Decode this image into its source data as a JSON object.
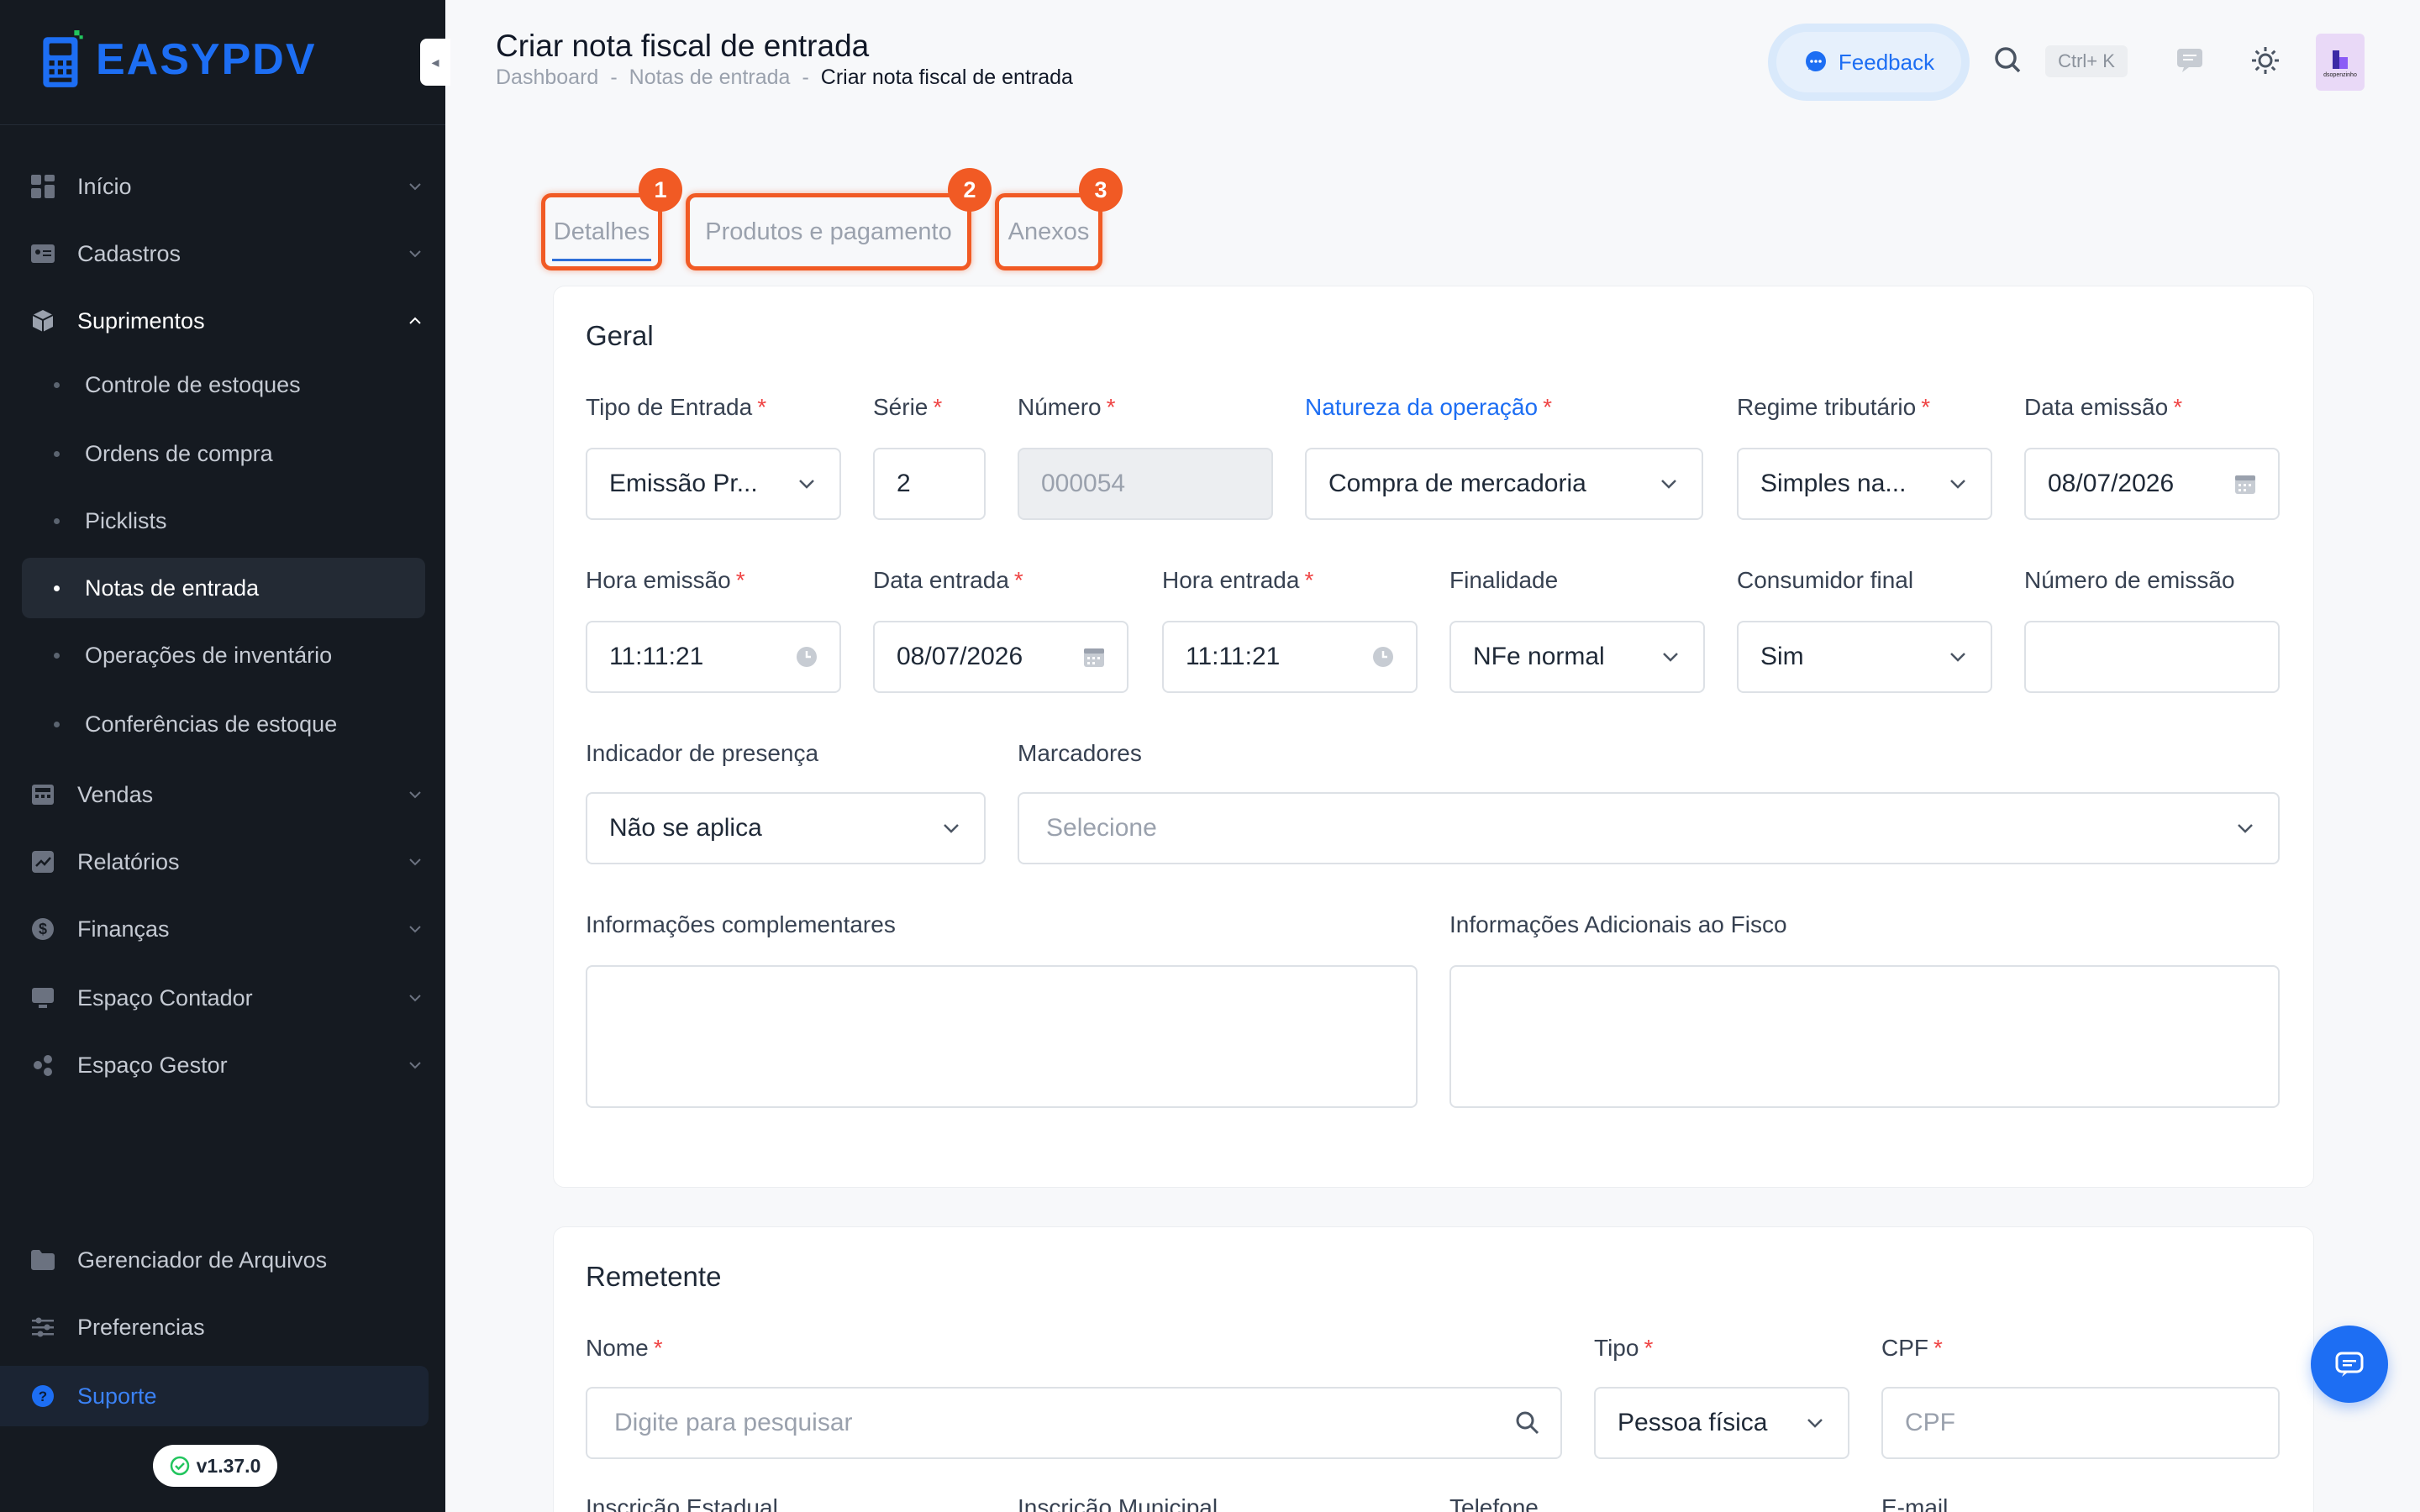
{
  "app": {
    "logo_easy": "EASY",
    "logo_pdv": "PDV",
    "version": "v1.37.0"
  },
  "sidebar": {
    "items": [
      {
        "label": "Início",
        "icon": "dashboard-icon"
      },
      {
        "label": "Cadastros",
        "icon": "id-card-icon"
      },
      {
        "label": "Suprimentos",
        "icon": "box-icon",
        "expanded": true
      },
      {
        "label": "Vendas",
        "icon": "register-icon"
      },
      {
        "label": "Relatórios",
        "icon": "chart-icon"
      },
      {
        "label": "Finanças",
        "icon": "dollar-icon"
      },
      {
        "label": "Espaço Contador",
        "icon": "monitor-icon"
      },
      {
        "label": "Espaço Gestor",
        "icon": "people-icon"
      }
    ],
    "sub_items": [
      {
        "label": "Controle de estoques"
      },
      {
        "label": "Ordens de compra"
      },
      {
        "label": "Picklists"
      },
      {
        "label": "Notas de entrada",
        "active": true
      },
      {
        "label": "Operações de inventário"
      },
      {
        "label": "Conferências de estoque"
      }
    ],
    "bottom": [
      {
        "label": "Gerenciador de Arquivos",
        "icon": "folder-icon"
      },
      {
        "label": "Preferencias",
        "icon": "sliders-icon"
      }
    ],
    "support": "Suporte"
  },
  "header": {
    "title": "Criar nota fiscal de entrada",
    "breadcrumb": [
      "Dashboard",
      "-",
      "Notas de entrada",
      "-",
      "Criar nota fiscal de entrada"
    ],
    "feedback": "Feedback",
    "shortcut": "Ctrl+ K",
    "avatar_text": "dsopenzinho"
  },
  "tabs": [
    {
      "label": "Detalhes",
      "badge": "1",
      "active": true
    },
    {
      "label": "Produtos e pagamento",
      "badge": "2"
    },
    {
      "label": "Anexos",
      "badge": "3"
    }
  ],
  "geral": {
    "title": "Geral",
    "tipo_entrada": {
      "label": "Tipo de Entrada",
      "value": "Emissão Pr..."
    },
    "serie": {
      "label": "Série",
      "value": "2"
    },
    "numero": {
      "label": "Número",
      "value": "000054"
    },
    "natureza": {
      "label": "Natureza da operação",
      "value": "Compra de mercadoria"
    },
    "regime": {
      "label": "Regime tributário",
      "value": "Simples na..."
    },
    "data_emissao": {
      "label": "Data emissão",
      "value": "08/07/2026"
    },
    "hora_emissao": {
      "label": "Hora emissão",
      "value": "11:11:21"
    },
    "data_entrada": {
      "label": "Data entrada",
      "value": "08/07/2026"
    },
    "hora_entrada": {
      "label": "Hora entrada",
      "value": "11:11:21"
    },
    "finalidade": {
      "label": "Finalidade",
      "value": "NFe normal"
    },
    "consumidor_final": {
      "label": "Consumidor final",
      "value": "Sim"
    },
    "numero_emissao": {
      "label": "Número de emissão",
      "value": ""
    },
    "indicador_presenca": {
      "label": "Indicador de presença",
      "value": "Não se aplica"
    },
    "marcadores": {
      "label": "Marcadores",
      "placeholder": "Selecione"
    },
    "info_complementares": {
      "label": "Informações complementares"
    },
    "info_fisco": {
      "label": "Informações Adicionais ao Fisco"
    }
  },
  "remetente": {
    "title": "Remetente",
    "nome": {
      "label": "Nome",
      "placeholder": "Digite para pesquisar"
    },
    "tipo": {
      "label": "Tipo",
      "value": "Pessoa física"
    },
    "cpf": {
      "label": "CPF",
      "placeholder": "CPF"
    },
    "inscricao_estadual": {
      "label": "Inscrição Estadual"
    },
    "inscricao_municipal": {
      "label": "Inscrição Municipal"
    },
    "telefone": {
      "label": "Telefone"
    },
    "email": {
      "label": "E-mail"
    }
  },
  "required_mark": "*"
}
